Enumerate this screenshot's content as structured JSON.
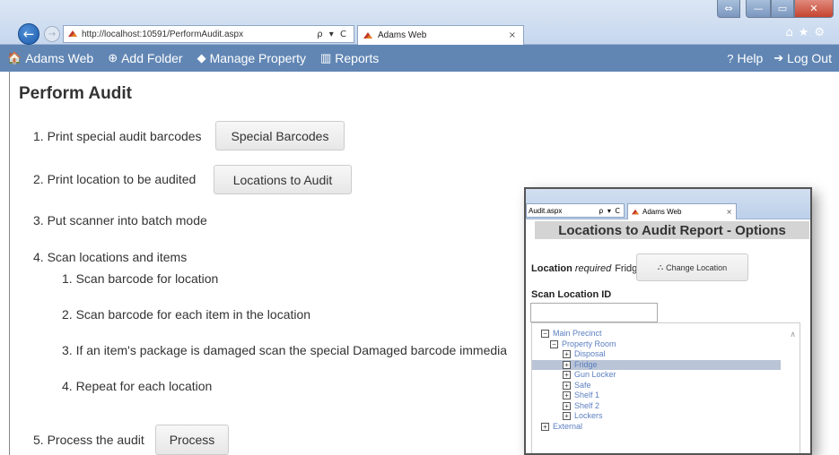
{
  "browser": {
    "url": "http://localhost:10591/PerformAudit.aspx",
    "tab_title": "Adams Web",
    "tab_close": "×",
    "window_controls": {
      "swap": "⇔",
      "minimize": "—",
      "maximize": "▭",
      "close": "✕"
    },
    "tool_icons": "⌂★⚙"
  },
  "navbar": {
    "items": [
      {
        "label": "Adams Web",
        "icon": "home-icon",
        "glyph": "🏠"
      },
      {
        "label": "Add Folder",
        "icon": "plus-circle-icon",
        "glyph": "⊕"
      },
      {
        "label": "Manage Property",
        "icon": "tag-icon",
        "glyph": "◆"
      },
      {
        "label": "Reports",
        "icon": "bar-chart-icon",
        "glyph": "▥"
      }
    ],
    "right_items": [
      {
        "label": "Help",
        "icon": "question-icon",
        "glyph": "?"
      },
      {
        "label": "Log Out",
        "icon": "logout-icon",
        "glyph": "➔"
      }
    ],
    "color": "#6186b4"
  },
  "page": {
    "title": "Perform Audit",
    "steps": [
      "1. Print special audit barcodes",
      "2. Print location to be audited",
      "3. Put scanner into batch mode",
      "4. Scan locations and items",
      "5. Process the audit"
    ],
    "substeps": [
      "1. Scan barcode for location",
      "2. Scan barcode for each item in the location",
      "3. If an item's package is damaged scan the special Damaged barcode immedia",
      "4. Repeat for each location"
    ],
    "buttons": {
      "special_barcodes": "Special Barcodes",
      "locations_to_audit": "Locations to Audit",
      "process": "Process"
    }
  },
  "popup": {
    "url_fragment": "Audit.aspx",
    "addr_ctrls": "ρ ▾ C",
    "tab_title": "Adams Web",
    "tab_close": "×",
    "title": "Locations to Audit Report - Options",
    "location_label": "Location",
    "location_required": "required",
    "location_value": "Fridge",
    "change_location_label": "Change Location",
    "scan_location_label": "Scan Location ID",
    "scan_location_value": "",
    "tree": [
      {
        "label": "Main Precinct",
        "toggle": "−",
        "level": 0
      },
      {
        "label": "Property Room",
        "toggle": "−",
        "level": 1
      },
      {
        "label": "Disposal",
        "toggle": "+",
        "level": 2
      },
      {
        "label": "Fridge",
        "toggle": "+",
        "level": 2,
        "selected": true
      },
      {
        "label": "Gun Locker",
        "toggle": "+",
        "level": 2
      },
      {
        "label": "Safe",
        "toggle": "+",
        "level": 2
      },
      {
        "label": "Shelf 1",
        "toggle": "+",
        "level": 2
      },
      {
        "label": "Shelf 2",
        "toggle": "+",
        "level": 2
      },
      {
        "label": "Lockers",
        "toggle": "+",
        "level": 2
      },
      {
        "label": "External",
        "toggle": "+",
        "level": 0
      }
    ]
  }
}
